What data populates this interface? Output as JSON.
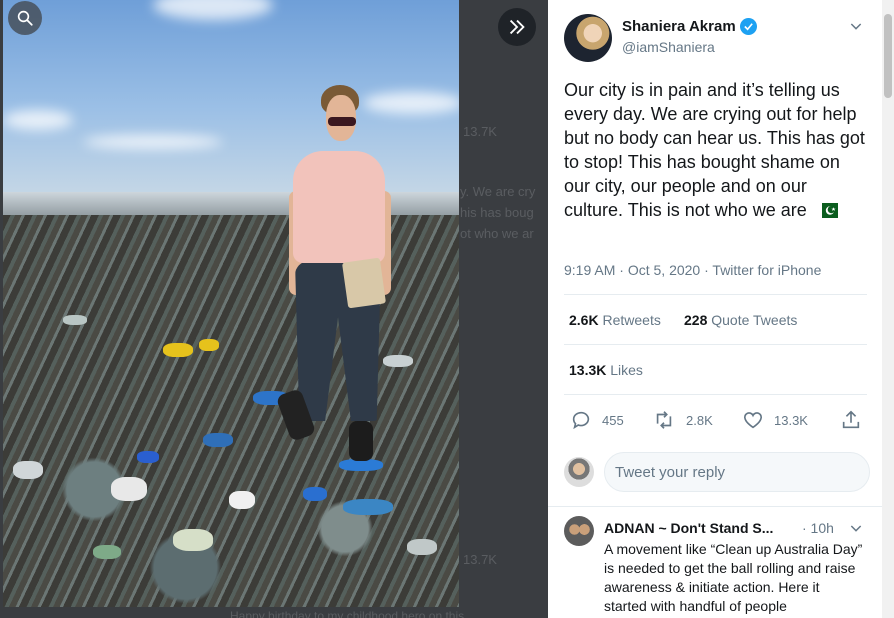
{
  "media": {
    "search_icon": "search-icon",
    "collapse_icon": "double-chevron-right-icon",
    "ghost_counts": [
      "13.7K",
      "13.7K"
    ],
    "ghost_lines": [
      "y. We are cry",
      "his has boug",
      "ot who we ar"
    ],
    "ghost_footer": "Happy birthday to my childhood hero on this..."
  },
  "tweet": {
    "author_name": "Shaniera Akram",
    "author_handle": "@iamShaniera",
    "verified": true,
    "text": "Our city is in pain and it’s telling us every day. We are crying out for help but no body can hear us. This has got to stop! This has bought shame on our city, our people and on our culture. This is not who we are",
    "flag_icon": "pakistan-flag-icon",
    "time": "9:19 AM",
    "date": "Oct 5, 2020",
    "source": "Twitter for iPhone",
    "retweets_count": "2.6K",
    "retweets_label": "Retweets",
    "quotes_count": "228",
    "quotes_label": "Quote Tweets",
    "likes_count": "13.3K",
    "likes_label": "Likes"
  },
  "actions": {
    "reply_count": "455",
    "retweet_count": "2.8K",
    "like_count": "13.3K"
  },
  "reply_box": {
    "placeholder": "Tweet your reply"
  },
  "reply": {
    "name": "ADNAN ~ Don't Stand S...",
    "time": "· 10h",
    "text": "A movement like “Clean up Australia Day” is needed to get the ball rolling and raise awareness & initiate action. Here it started with handful of people"
  },
  "colors": {
    "accent": "#1da1f2",
    "text_primary": "#14171a",
    "text_secondary": "#657786",
    "divider": "#e6ecf0"
  }
}
